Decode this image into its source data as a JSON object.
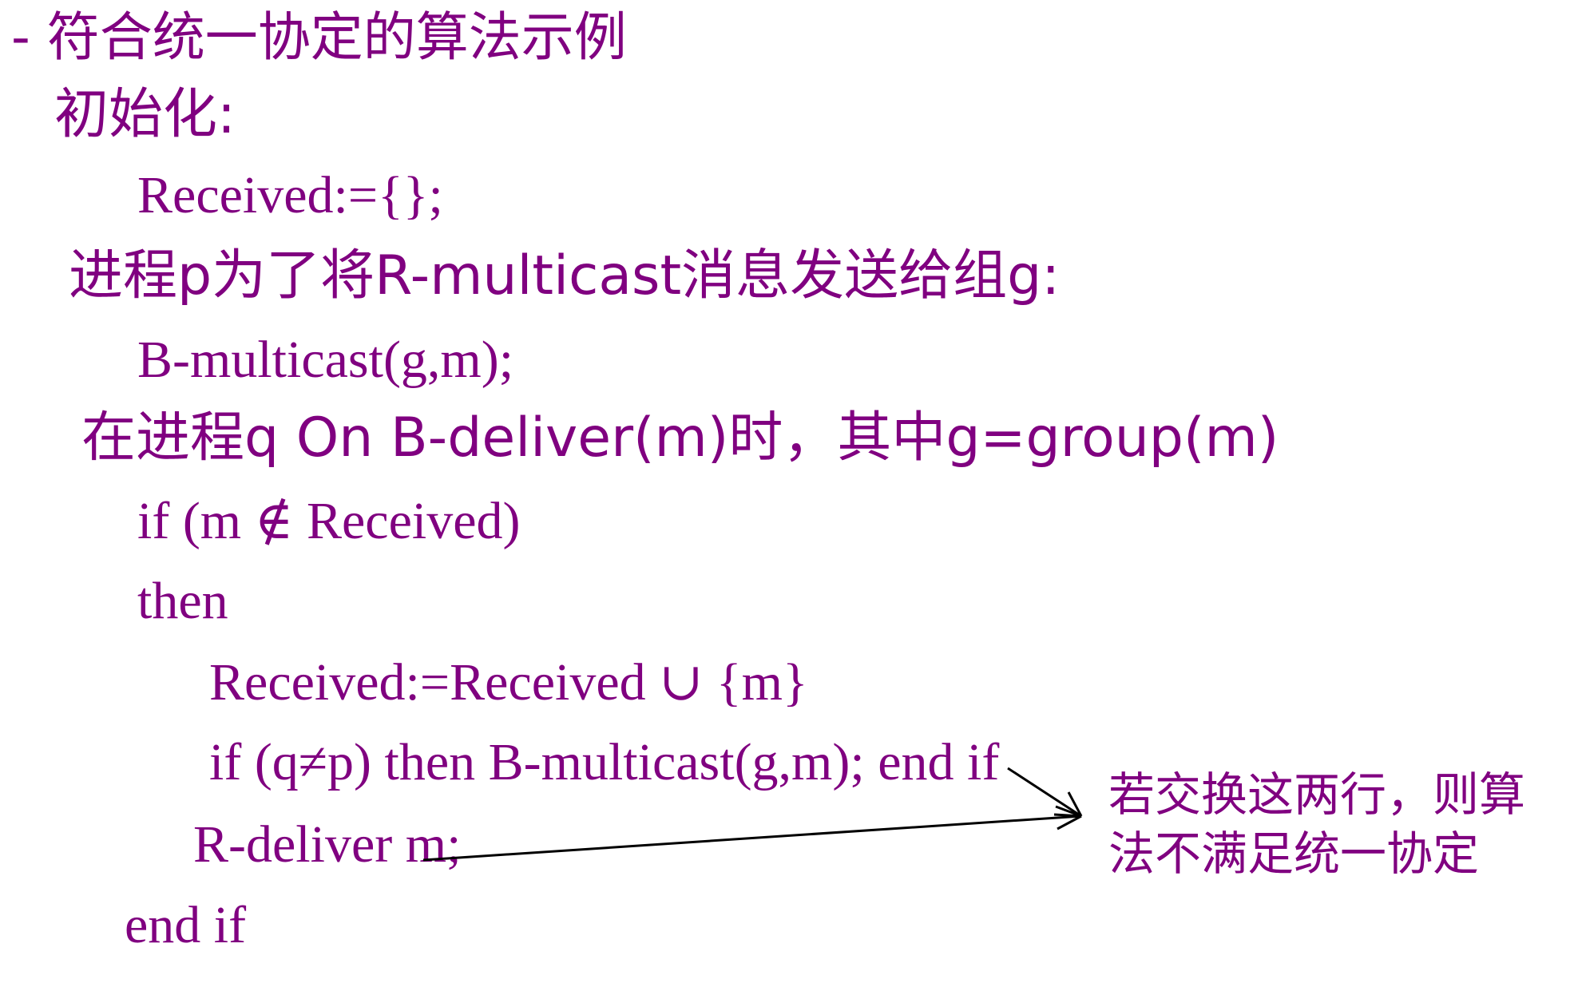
{
  "lines": {
    "title": "- 符合统一协定的算法示例",
    "init_heading": "初始化:",
    "init_stmt": "Received:={};",
    "send_heading": "进程p为了将R-multicast消息发送给组g:",
    "send_stmt": "B-multicast(g,m);",
    "deliver_heading": "在进程q On B-deliver(m)时，其中g=group(m)",
    "if_cond": "if (m ∉ Received)",
    "then_kw": "then",
    "update_stmt": "Received:=Received ∪ {m}",
    "relay_stmt": "if (q≠p) then B-multicast(g,m); end if",
    "rdeliver_stmt": "R-deliver m;",
    "end_if": "end if"
  },
  "annotation": {
    "line1": "若交换这两行，则算",
    "line2": "法不满足统一协定"
  },
  "colors": {
    "text": "#800080",
    "arrow": "#000000",
    "background": "#ffffff"
  }
}
